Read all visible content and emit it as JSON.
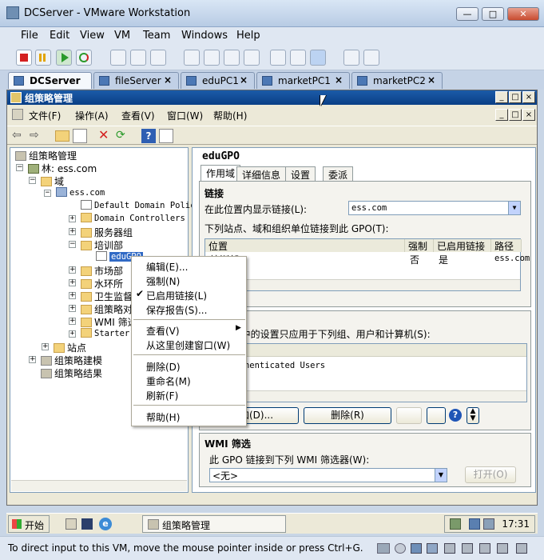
{
  "window": {
    "title": "DCServer - VMware Workstation",
    "controls": {
      "minimize": "—",
      "maximize": "□",
      "close": "✕"
    }
  },
  "menu": [
    "File",
    "Edit",
    "View",
    "VM",
    "Team",
    "Windows",
    "Help"
  ],
  "tabs": [
    {
      "label": "DCServer",
      "active": true
    },
    {
      "label": "fileServer"
    },
    {
      "label": "eduPC1"
    },
    {
      "label": "marketPC1"
    },
    {
      "label": "marketPC2"
    }
  ],
  "guest": {
    "title": "组策略管理",
    "menu": [
      "文件(F)",
      "操作(A)",
      "查看(V)",
      "窗口(W)",
      "帮助(H)"
    ],
    "tree": {
      "root": "组策略管理",
      "forest": "林: ess.com",
      "domains": "域",
      "domain": "ess.com",
      "items": [
        "Default Domain Policy",
        "Domain Controllers",
        "服务器组",
        "培训部",
        "eduGPO",
        "市场部",
        "水环所",
        "卫生监督",
        "组策略对象",
        "WMI 筛选器",
        "Starter GPO"
      ],
      "sites": "站点",
      "modeling": "组策略建模",
      "results": "组策略结果"
    },
    "right": {
      "gpo_name": "eduGPO",
      "tabs": [
        "作用域",
        "详细信息",
        "设置",
        "委派"
      ],
      "links_heading": "链接",
      "display_links_label": "在此位置内显示链接(L):",
      "display_links_value": "ess.com",
      "linked_label": "下列站点、域和组织单位链接到此 GPO(T):",
      "grid_headers": [
        "位置",
        "强制",
        "已启用链接",
        "路径"
      ],
      "grid_row": {
        "location": "培训部",
        "enforced": "否",
        "enabled": "是",
        "path": "ess.com"
      },
      "filter_label": "此 GPO 中的设置只应用于下列组、用户和计算机(S):",
      "filter_value": "Authenticated Users",
      "add_button": "添加(D)...",
      "remove_button": "删除(R)",
      "wmi_heading": "WMI 筛选",
      "wmi_label": "此 GPO 链接到下列 WMI 筛选器(W):",
      "wmi_value": "<无>",
      "open_button": "打开(O)"
    },
    "context_menu": {
      "items": [
        "编辑(E)...",
        "强制(N)",
        "已启用链接(L)",
        "保存报告(S)...",
        "查看(V)",
        "从这里创建窗口(W)",
        "删除(D)",
        "重命名(M)",
        "刷新(F)",
        "帮助(H)"
      ],
      "checked": "已启用链接(L)"
    },
    "taskbar": {
      "start": "开始",
      "task": "组策略管理",
      "clock": "17:31"
    }
  },
  "status": "To direct input to this VM, move the mouse pointer inside or press Ctrl+G."
}
